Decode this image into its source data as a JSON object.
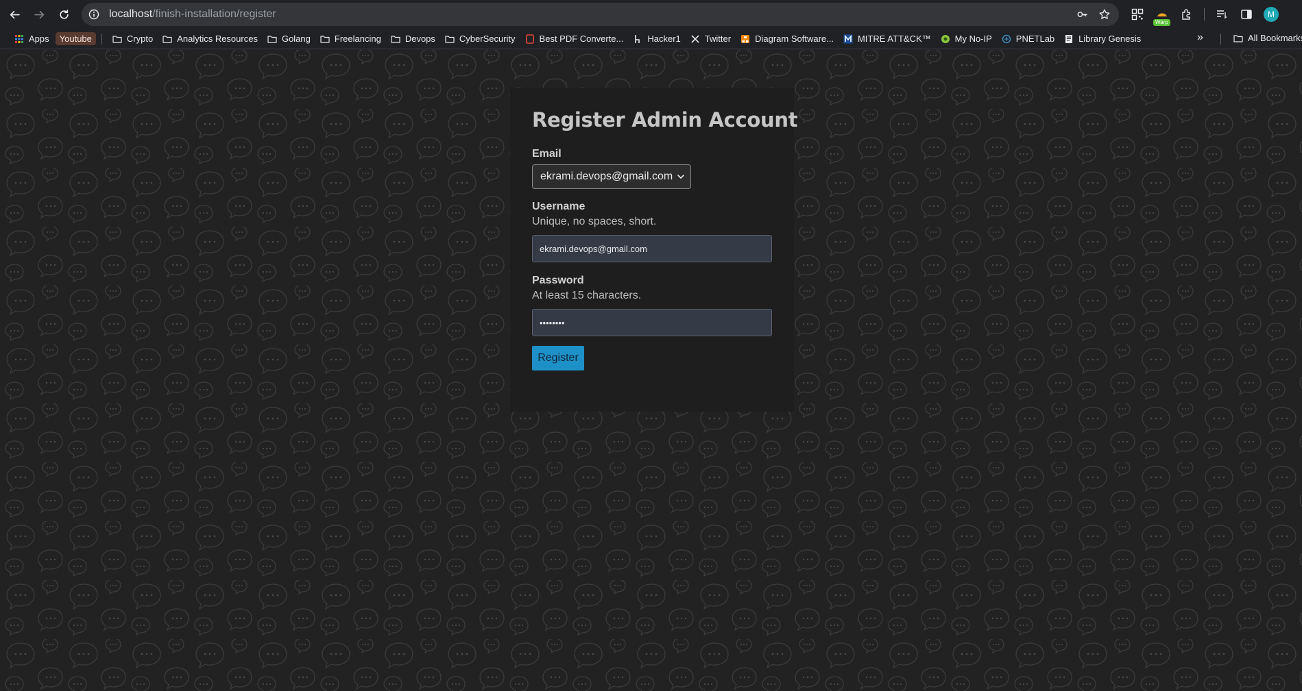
{
  "browser": {
    "url_host": "localhost",
    "url_path": "/finish-installation/register",
    "extension_badge": "Warp",
    "profile_initial": "M",
    "icons": [
      "back-icon",
      "forward-icon",
      "reload-icon",
      "site-info-icon",
      "key-icon",
      "star-icon",
      "qr-icon",
      "extensions-icon",
      "reading-list-icon",
      "side-panel-icon"
    ]
  },
  "bookmarks": {
    "items": [
      {
        "label": "Apps",
        "icon": "apps-grid-icon"
      },
      {
        "label": "Youtube",
        "icon": "chip"
      },
      {
        "label": "Crypto",
        "icon": "folder-icon"
      },
      {
        "label": "Analytics Resources",
        "icon": "folder-icon"
      },
      {
        "label": "Golang",
        "icon": "folder-icon"
      },
      {
        "label": "Freelancing",
        "icon": "folder-icon"
      },
      {
        "label": "Devops",
        "icon": "folder-icon"
      },
      {
        "label": "CyberSecurity",
        "icon": "folder-icon"
      },
      {
        "label": "Best PDF Converte...",
        "icon": "pdf-icon"
      },
      {
        "label": "Hacker1",
        "icon": "h1-icon"
      },
      {
        "label": "Twitter",
        "icon": "x-icon"
      },
      {
        "label": "Diagram Software...",
        "icon": "diagram-icon"
      },
      {
        "label": "MITRE ATT&CK™",
        "icon": "mitre-icon"
      },
      {
        "label": "My No-IP",
        "icon": "noip-icon"
      },
      {
        "label": "PNETLab",
        "icon": "pnetlab-icon"
      },
      {
        "label": "Library Genesis",
        "icon": "book-icon"
      }
    ],
    "more": "»",
    "all_bookmarks": "All Bookmarks"
  },
  "form": {
    "title": "Register Admin Account",
    "email_label": "Email",
    "email_value": "ekrami.devops@gmail.com",
    "username_label": "Username",
    "username_hint": "Unique, no spaces, short.",
    "username_value": "ekrami.devops@gmail.com",
    "password_label": "Password",
    "password_hint": "At least 15 characters.",
    "password_masked": "••••••••",
    "submit_label": "Register"
  },
  "colors": {
    "page_bg": "#222222",
    "card_bg": "#1e1e1e",
    "input_bg": "#343a46",
    "button_bg": "#1e90c8",
    "pattern_stroke": "#3a3a3a"
  }
}
